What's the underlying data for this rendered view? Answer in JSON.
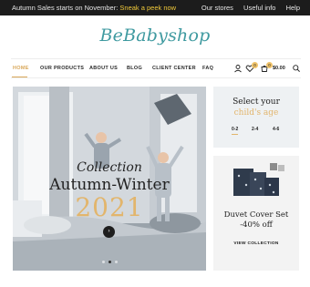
{
  "topbar": {
    "promo_text": "Autumn Sales starts on November: ",
    "promo_link": "Sneak a peek now",
    "links": [
      "Our stores",
      "Useful info",
      "Help"
    ]
  },
  "logo": {
    "text": "BeBabyshop"
  },
  "nav": {
    "items": [
      "HOME",
      "OUR PRODUCTS",
      "ABOUT US",
      "BLOG",
      "CLIENT CENTER",
      "FAQ"
    ],
    "wishlist_count": "0",
    "cart_count": "0",
    "cart_total": "$0.00"
  },
  "hero": {
    "collection_label": "Collection",
    "season": "Autumn-Winter",
    "year": "2021",
    "next_arrow": "›"
  },
  "age_box": {
    "line1": "Select your",
    "line2": "child's age",
    "ages": [
      "0-2",
      "2-4",
      "4-6"
    ]
  },
  "promo_box": {
    "title": "Duvet Cover Set",
    "discount": "-40% off",
    "cta": "VIEW COLLECTION"
  },
  "colors": {
    "accent_gold": "#e2b56c",
    "logo_teal": "#3f9aa0",
    "topbar_bg": "#1c1c1c"
  }
}
